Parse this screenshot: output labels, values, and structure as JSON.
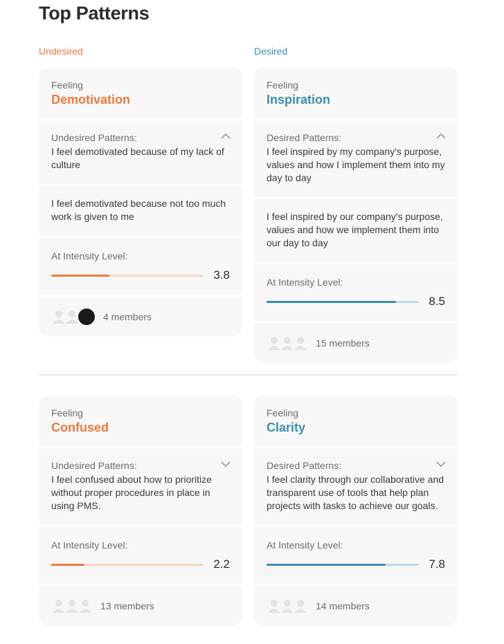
{
  "page": {
    "title": "Top Patterns"
  },
  "columns": {
    "undesired": "Undesired",
    "desired": "Desired"
  },
  "cards": [
    {
      "kind": "undesired",
      "feeling_label": "Feeling",
      "feeling": "Demotivation",
      "patterns_label": "Undesired Patterns:",
      "expanded": true,
      "patterns": [
        "I feel demotivated because of my lack of culture",
        "I feel demotivated because not too much work is given to me"
      ],
      "intensity_label": "At Intensity Level:",
      "intensity": "3.8",
      "intensity_fraction": 0.38,
      "members": "4 members"
    },
    {
      "kind": "desired",
      "feeling_label": "Feeling",
      "feeling": "Inspiration",
      "patterns_label": "Desired Patterns:",
      "expanded": true,
      "patterns": [
        "I feel inspired by my company's purpose, values and how I implement them into my day to day",
        "I feel inspired by our company's purpose, values and how we implement them into our day to day"
      ],
      "intensity_label": "At Intensity Level:",
      "intensity": "8.5",
      "intensity_fraction": 0.85,
      "members": "15 members"
    },
    {
      "kind": "undesired",
      "feeling_label": "Feeling",
      "feeling": "Confused",
      "patterns_label": "Undesired Patterns:",
      "expanded": false,
      "patterns": [
        "I feel confused about how to prioritize without proper procedures in place in using PMS."
      ],
      "intensity_label": "At Intensity Level:",
      "intensity": "2.2",
      "intensity_fraction": 0.22,
      "members": "13 members"
    },
    {
      "kind": "desired",
      "feeling_label": "Feeling",
      "feeling": "Clarity",
      "patterns_label": "Desired Patterns:",
      "expanded": false,
      "patterns": [
        "I feel clarity through our collaborative and transparent use of tools that help plan projects with tasks to achieve our goals."
      ],
      "intensity_label": "At Intensity Level:",
      "intensity": "7.8",
      "intensity_fraction": 0.78,
      "members": "14 members"
    }
  ],
  "colors": {
    "undesired": "#ee7a3a",
    "desired": "#3b8fb0"
  }
}
